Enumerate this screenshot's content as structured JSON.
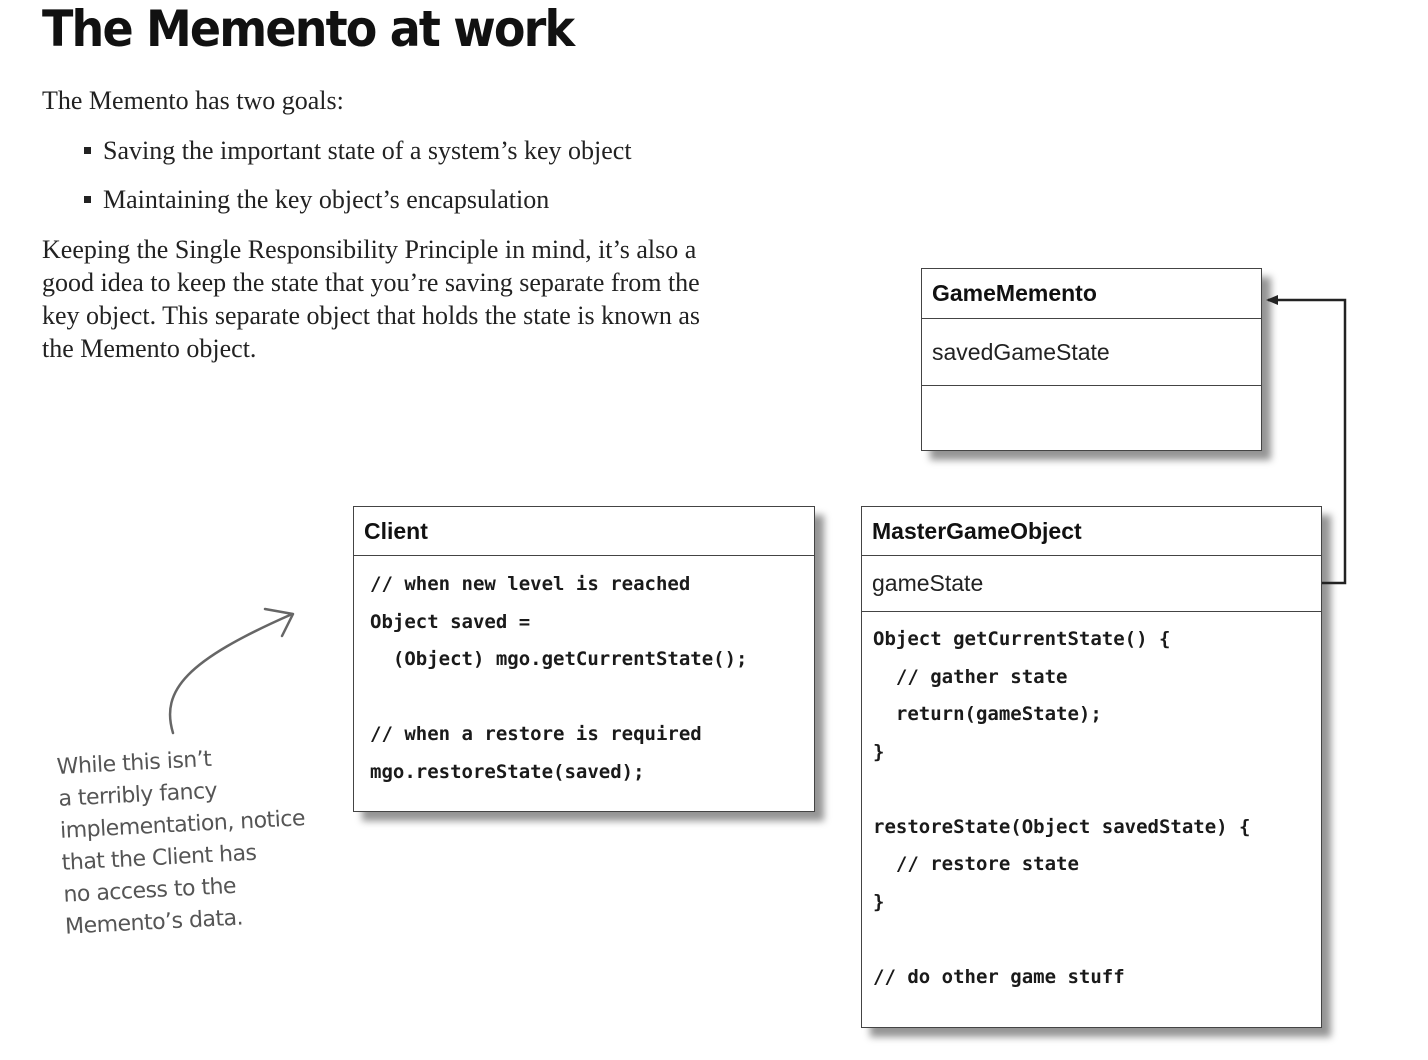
{
  "page": {
    "title": "The Memento at work",
    "intro": "The Memento has two goals:",
    "bullets": [
      "Saving the important state of a system’s key object",
      "Maintaining the key object’s encapsulation"
    ],
    "paragraph": "Keeping the Single Responsibility Principle in mind, it’s also a good idea to keep the state that you’re saving separate from the key object. This separate object that holds the state is known as the Memento object."
  },
  "diagram": {
    "game_memento": {
      "name": "GameMemento",
      "attribute": "savedGameState"
    },
    "client": {
      "name": "Client",
      "code": "// when new level is reached\nObject saved =\n  (Object) mgo.getCurrentState();\n\n// when a restore is required\nmgo.restoreState(saved);"
    },
    "master_game_object": {
      "name": "MasterGameObject",
      "attribute": "gameState",
      "code": "Object getCurrentState() {\n  // gather state\n  return(gameState);\n}\n\nrestoreState(Object savedState) {\n  // restore state\n}\n\n// do other game stuff"
    },
    "annotation": "While this isn’t\na terribly fancy\nimplementation, notice\nthat the Client has\nno access to the\nMemento’s data."
  }
}
